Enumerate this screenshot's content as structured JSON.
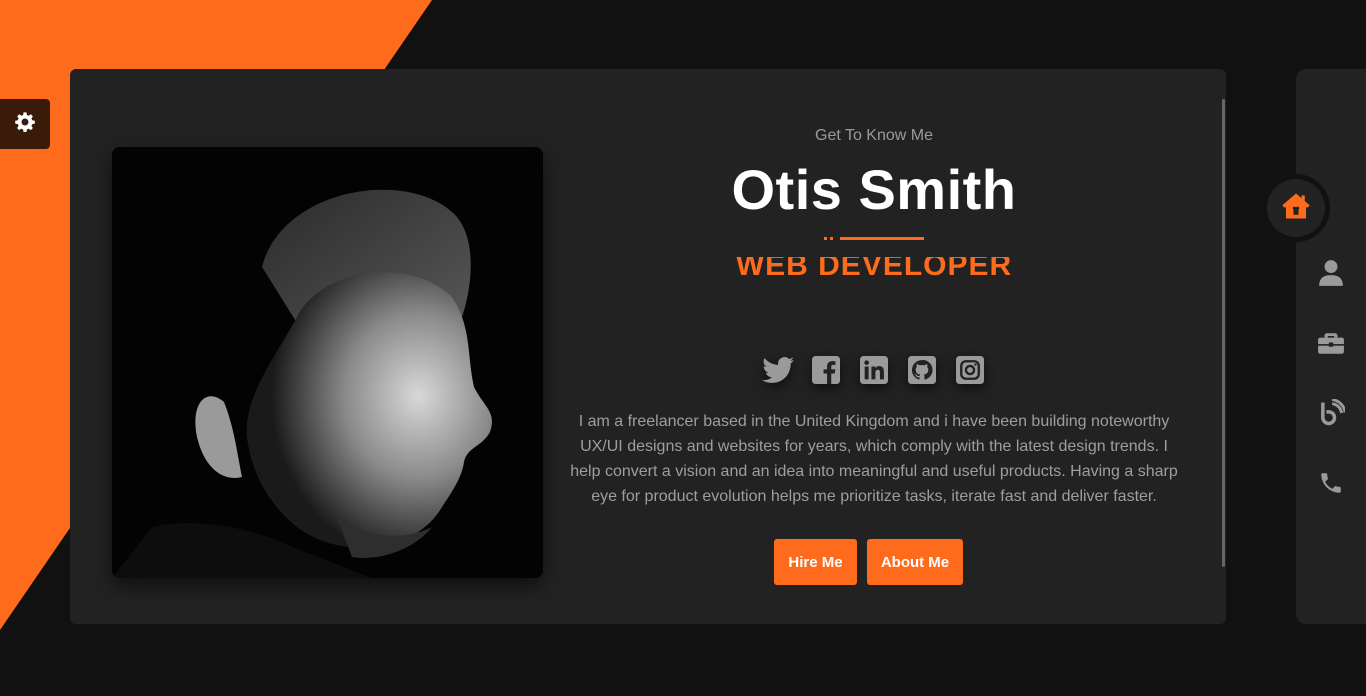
{
  "hero": {
    "eyebrow": "Get To Know Me",
    "name": "Otis Smith",
    "role": "WEB DEVELOPER",
    "bio": "I am a freelancer based in the United Kingdom and i have been building noteworthy UX/UI designs and websites for years, which comply with the latest design trends. I help convert a vision and an idea into meaningful and useful products. Having a sharp eye for product evolution helps me prioritize tasks, iterate fast and deliver faster.",
    "buttons": {
      "hire_label": "Hire Me",
      "about_label": "About Me"
    }
  },
  "socials": [
    "twitter-icon",
    "facebook-icon",
    "linkedin-icon",
    "github-icon",
    "instagram-icon"
  ],
  "side_nav": {
    "active": "home-icon",
    "items": [
      "home-icon",
      "user-icon",
      "briefcase-icon",
      "blog-icon",
      "phone-icon"
    ]
  },
  "settings_icon": "gear-icon",
  "colors": {
    "accent": "#ff6b1c",
    "background": "#111111",
    "card": "#222222",
    "text_muted": "#9e9e9e",
    "icon_muted": "#9a9a9a"
  }
}
